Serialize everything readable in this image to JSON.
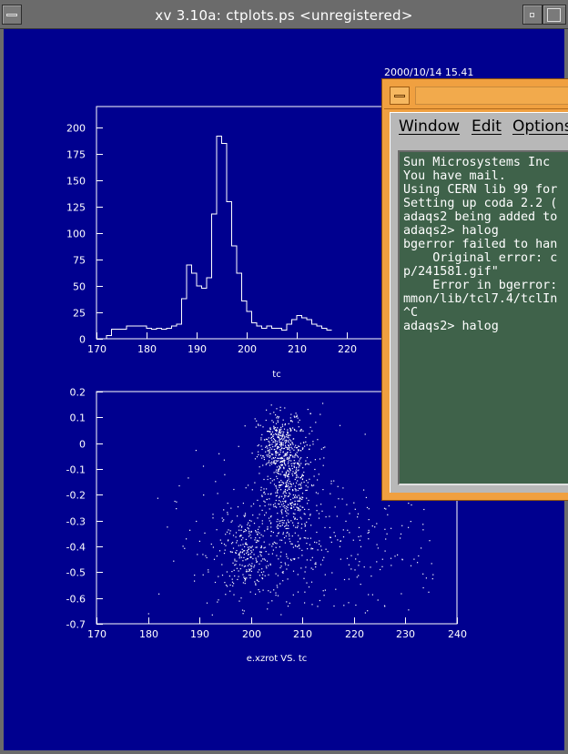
{
  "window": {
    "title": "xv 3.10a: ctplots.ps <unregistered>",
    "colors": {
      "background": "#00008f",
      "foreground": "#ffffff",
      "frame": "#6b6b6b"
    }
  },
  "icons": {
    "window_menu": "window-menu-icon",
    "minimize": "minimize-icon",
    "maximize": "maximize-icon"
  },
  "plot_timestamp": "2000/10/14  15.41",
  "chart_data": [
    {
      "type": "histogram",
      "xlabel": "tc",
      "ylabel": "",
      "title": "",
      "xlim": [
        170,
        242
      ],
      "ylim": [
        0,
        220
      ],
      "x_ticks": [
        170,
        180,
        190,
        200,
        210,
        220
      ],
      "y_ticks": [
        0,
        25,
        50,
        75,
        100,
        125,
        150,
        175,
        200
      ],
      "bin_width": 1,
      "bin_start": 172,
      "values": [
        3,
        9,
        9,
        9,
        12,
        12,
        12,
        12,
        10,
        9,
        10,
        9,
        10,
        12,
        14,
        38,
        70,
        62,
        50,
        48,
        58,
        118,
        192,
        185,
        130,
        88,
        62,
        36,
        26,
        15,
        12,
        10,
        12,
        10,
        10,
        8,
        14,
        18,
        22,
        20,
        18,
        14,
        12,
        10,
        8
      ]
    },
    {
      "type": "scatter",
      "xlabel": "e.xzrot VS. tc",
      "ylabel": "",
      "title": "",
      "xlim": [
        170,
        240
      ],
      "ylim": [
        -0.7,
        0.2
      ],
      "x_ticks": [
        170,
        180,
        190,
        200,
        210,
        220,
        230,
        240
      ],
      "y_ticks": [
        -0.7,
        -0.6,
        -0.5,
        -0.4,
        -0.3,
        -0.2,
        -0.1,
        0,
        0.1,
        0.2
      ],
      "point_count": 1500,
      "clusters": [
        {
          "x": 205,
          "y": 0.0,
          "sx": 1.8,
          "sy": 0.06,
          "weight": 0.16
        },
        {
          "x": 207,
          "y": -0.18,
          "sx": 2.2,
          "sy": 0.12,
          "weight": 0.26
        },
        {
          "x": 199,
          "y": -0.42,
          "sx": 2.2,
          "sy": 0.08,
          "weight": 0.14
        },
        {
          "x": 208,
          "y": -0.05,
          "sx": 3.5,
          "sy": 0.1,
          "weight": 0.12
        },
        {
          "x": 210,
          "y": -0.4,
          "sx": 14,
          "sy": 0.15,
          "weight": 0.32
        }
      ]
    }
  ],
  "terminal": {
    "menus": [
      "Window",
      "Edit",
      "Options"
    ],
    "lines": [
      "Sun Microsystems Inc",
      "You have mail.",
      "Using CERN lib 99 for",
      "Setting up coda 2.2 (",
      "adaqs2 being added to",
      "adaqs2> halog",
      "bgerror failed to han",
      "    Original error: c",
      "p/241581.gif\"",
      "    Error in bgerror:",
      "mmon/lib/tcl7.4/tclIn",
      "^C",
      "adaqs2> halog"
    ]
  }
}
